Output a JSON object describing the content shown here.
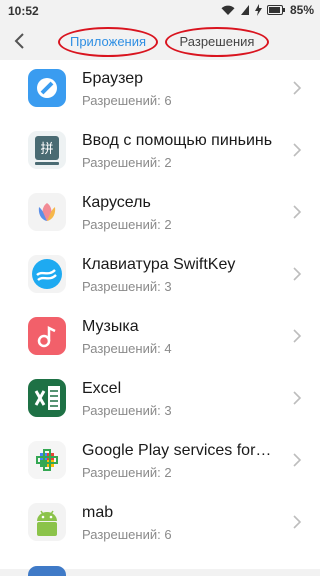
{
  "status": {
    "time": "10:52",
    "battery": "85%"
  },
  "tabs": {
    "apps": "Приложения",
    "permissions": "Разрешения"
  },
  "apps": [
    {
      "name": "Браузер",
      "permissions": "Разрешений: 6",
      "icon": "browser-icon",
      "color": "#3a9cf0"
    },
    {
      "name": "Ввод с помощью пиньинь",
      "permissions": "Разрешений: 2",
      "icon": "pinyin-keyboard-icon",
      "color": "#4a6b73"
    },
    {
      "name": "Карусель",
      "permissions": "Разрешений: 2",
      "icon": "carousel-flower-icon",
      "color": "#f5a0a5"
    },
    {
      "name": "Клавиатура SwiftKey",
      "permissions": "Разрешений: 3",
      "icon": "swiftkey-icon",
      "color": "#1eaaf1"
    },
    {
      "name": "Музыка",
      "permissions": "Разрешений: 4",
      "icon": "music-icon",
      "color": "#f2606a"
    },
    {
      "name": "Excel",
      "permissions": "Разрешений: 3",
      "icon": "excel-icon",
      "color": "#1e7145"
    },
    {
      "name": "Google Play services for…",
      "permissions": "Разрешений: 2",
      "icon": "google-play-services-icon",
      "color": "#34a853"
    },
    {
      "name": "mab",
      "permissions": "Разрешений: 6",
      "icon": "android-icon",
      "color": "#8bc34a"
    }
  ]
}
